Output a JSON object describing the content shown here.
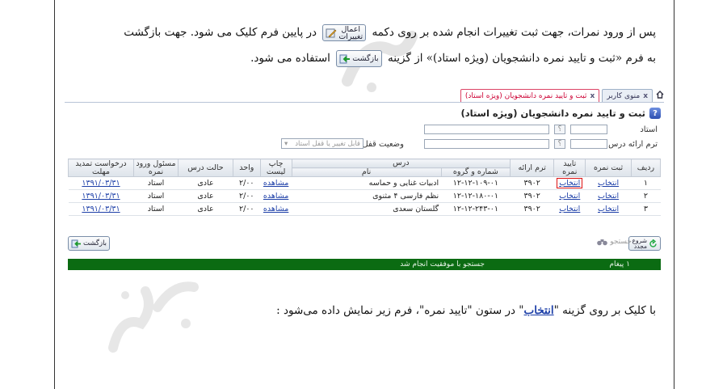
{
  "paragraph1": {
    "line1_before": "پس از ورود نمرات، جهت ثبت تغییرات انجام شده بر روی دکمه",
    "line1_after": "در پایین فرم کلیک می شود. جهت بازگشت",
    "save_button": {
      "line_a": "اعمال",
      "line_b": "تغییرات",
      "icon": "pencil-save-icon"
    },
    "line2_before": "به فرم «ثبت و تایید نمره دانشجویان (ویژه استاد)» از گزینه",
    "line2_after": "استفاده می شود.",
    "back_button": {
      "label": "بازگشت",
      "icon": "back-arrow-icon"
    }
  },
  "ui": {
    "tabs": [
      {
        "label": "منوی کاربر",
        "close": "x",
        "active": false
      },
      {
        "label": "ثبت و تایید نمره دانشجویان (ویژه استاد)",
        "close": "x",
        "active": true
      }
    ],
    "form_title": "ثبت و تایید نمره دانشجویان (ویژه استاد)",
    "fields": {
      "teacher_label": "استاد",
      "term_label": "ترم ارائه درس",
      "lock_status_label": "وضعیت قفل",
      "lock_status_value": "قابل تغییر یا قفل استاد",
      "qmark": "؟"
    },
    "table": {
      "headers": {
        "row": "ردیف",
        "register": "ثبت نمره",
        "confirm": "تایید نمره",
        "term": "ترم ارائه",
        "course": "درس",
        "course_number": "شماره و گروه",
        "course_name": "نام",
        "print": "چاپ لیست",
        "units": "واحد",
        "course_state": "حالت درس",
        "grade_entry": "مسئول ورود نمره",
        "deadline": "درخواست تمدید مهلت"
      },
      "rows": [
        {
          "row": "۱",
          "register": "انتخاب",
          "confirm": "انتخاب",
          "term": "۳۹۰۲",
          "course_number": "۱۲-۱۲-۱۰۹-۰۱",
          "course_name": "ادبیات غنایی و حماسه",
          "print": "مشاهده",
          "units": "۲/۰۰",
          "course_state": "عادی",
          "grade_entry": "استاد",
          "deadline": "۱۳۹۱/۰۳/۳۱"
        },
        {
          "row": "۲",
          "register": "انتخاب",
          "confirm": "انتخاب",
          "term": "۳۹۰۲",
          "course_number": "۱۲-۱۲-۱۸۰-۰۱",
          "course_name": "نظم فارسی ۴ مثنوی",
          "print": "مشاهده",
          "units": "۲/۰۰",
          "course_state": "عادی",
          "grade_entry": "استاد",
          "deadline": "۱۳۹۱/۰۳/۳۱"
        },
        {
          "row": "۳",
          "register": "انتخاب",
          "confirm": "انتخاب",
          "term": "۳۹۰۲",
          "course_number": "۱۲-۱۲-۲۴۳-۰۱",
          "course_name": "گلستان سعدی",
          "print": "مشاهده",
          "units": "۲/۰۰",
          "course_state": "عادی",
          "grade_entry": "استاد",
          "deadline": "۱۳۹۱/۰۳/۳۱"
        }
      ]
    },
    "toolbar": {
      "search_label": "جستجو",
      "refresh_a": "شروع",
      "refresh_b": "مجدد",
      "back_label": "بازگشت"
    },
    "status": {
      "message_count": "۱ پیغام",
      "message": "جستجو با موفقیت انجام شد"
    }
  },
  "paragraph2": {
    "before": "با کلیک بر روی گزینه \"",
    "highlight": "انتخاب",
    "after": "\" در ستون \"تایید نمره\"، فرم زیر نمایش داده می‌شود :"
  },
  "colors": {
    "status_bar": "#0b6b12",
    "link": "#1d3fa8",
    "highlight_border": "#dd1111",
    "active_tab": "#cc0033"
  }
}
